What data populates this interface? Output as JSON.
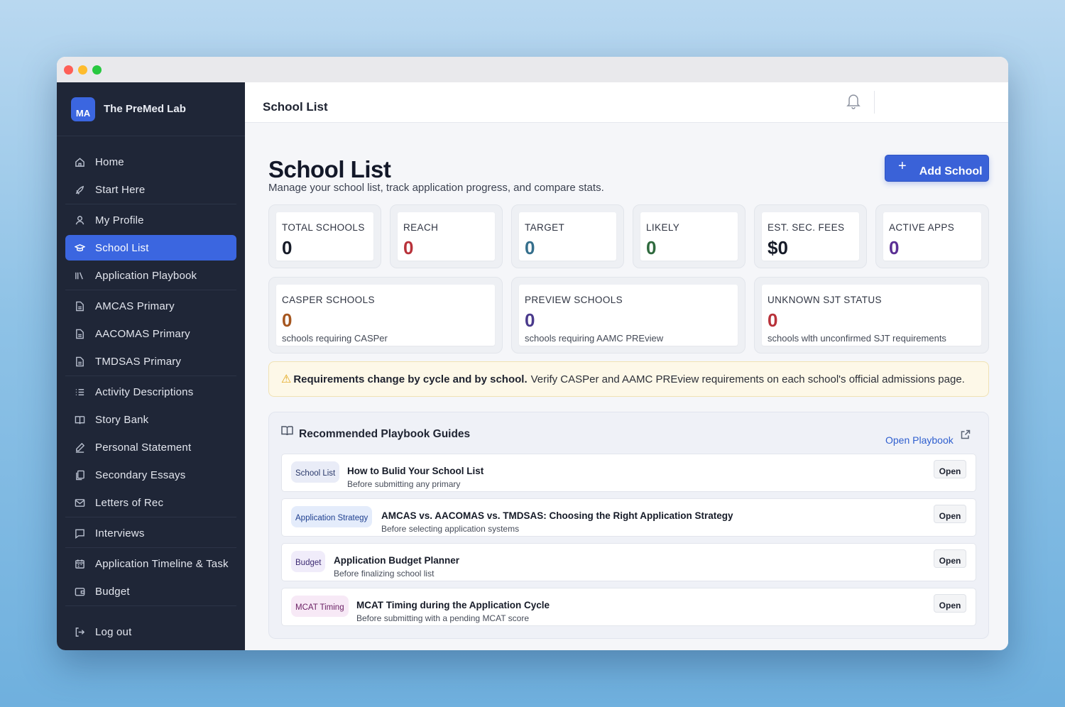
{
  "brand": {
    "initials": "MA",
    "name": "The PreMed Lab"
  },
  "sidebar": {
    "items": [
      {
        "label": "Home",
        "icon": "home-icon"
      },
      {
        "label": "Start Here",
        "icon": "rocket-icon"
      },
      {
        "label": "My Profile",
        "icon": "user-icon"
      },
      {
        "label": "School List",
        "icon": "graduation-cap-icon",
        "active": true
      },
      {
        "label": "Application Playbook",
        "icon": "library-icon"
      },
      {
        "label": "AMCAS Primary",
        "icon": "document-icon"
      },
      {
        "label": "AACOMAS Primary",
        "icon": "document-icon"
      },
      {
        "label": "TMDSAS Primary",
        "icon": "document-icon"
      },
      {
        "label": "Activity Descriptions",
        "icon": "list-icon"
      },
      {
        "label": "Story Bank",
        "icon": "book-icon"
      },
      {
        "label": "Personal Statement",
        "icon": "pen-icon"
      },
      {
        "label": "Secondary Essays",
        "icon": "copy-icon"
      },
      {
        "label": "Letters of Rec",
        "icon": "mail-icon"
      },
      {
        "label": "Interviews",
        "icon": "chat-icon"
      },
      {
        "label": "Application Timeline & Task",
        "icon": "calendar-icon"
      },
      {
        "label": "Budget",
        "icon": "wallet-icon"
      }
    ],
    "logout": "Log out"
  },
  "topbar": {
    "title": "School List"
  },
  "header": {
    "title": "School List",
    "subtitle": "Manage your school list, track application progress, and compare stats.",
    "add_button": "Add School"
  },
  "stats": [
    {
      "label": "TOTAL SCHOOLS",
      "value": "0",
      "color": "#161b28"
    },
    {
      "label": "REACH",
      "value": "0",
      "color": "#b8323a"
    },
    {
      "label": "TARGET",
      "value": "0",
      "color": "#356f8c"
    },
    {
      "label": "LIKELY",
      "value": "0",
      "color": "#2f6a3e"
    },
    {
      "label": "EST. SEC. FEES",
      "value": "$0",
      "color": "#161b28"
    },
    {
      "label": "ACTIVE APPS",
      "value": "0",
      "color": "#5b2f94"
    }
  ],
  "wide_stats": [
    {
      "label": "CASPER SCHOOLS",
      "value": "0",
      "desc": "schools requiring CASPer",
      "color": "#a5561f"
    },
    {
      "label": "PREVIEW SCHOOLS",
      "value": "0",
      "desc": "schools requiring AAMC PREview",
      "color": "#4a3a8c"
    },
    {
      "label": "UNKNOWN SJT STATUS",
      "value": "0",
      "desc": "schools wlth unconfirmed SJT requirements",
      "color": "#b8323a"
    }
  ],
  "banner": {
    "bold": "Requirements change by cycle and by school.",
    "text": "Verify CASPer and AAMC PREview requirements on each school's official admissions page."
  },
  "guides": {
    "heading": "Recommended Playbook Guides",
    "open_link": "Open Playbook",
    "rows": [
      {
        "tag": "School List",
        "tag_bg": "#e9ecf7",
        "tag_color": "#2b3a6b",
        "title": "How to Bulid Your School List",
        "sub": "Before submitting any primary",
        "open": "Open"
      },
      {
        "tag": "Application Strategy",
        "tag_bg": "#e4ecfb",
        "tag_color": "#1e3f8f",
        "title": "AMCAS vs. AACOMAS vs. TMDSAS: Choosing the Right Application Strategy",
        "sub": "Before selecting application systems",
        "open": "Open"
      },
      {
        "tag": "Budget",
        "tag_bg": "#f0ecfa",
        "tag_color": "#3d2b73",
        "title": "Application Budget Planner",
        "sub": "Before finalizing school list",
        "open": "Open"
      },
      {
        "tag": "MCAT Timing",
        "tag_bg": "#f7e9f6",
        "tag_color": "#6a1f63",
        "title": "MCAT Timing during the Application Cycle",
        "sub": "Before submitting with a pending MCAT score",
        "open": "Open"
      }
    ]
  }
}
